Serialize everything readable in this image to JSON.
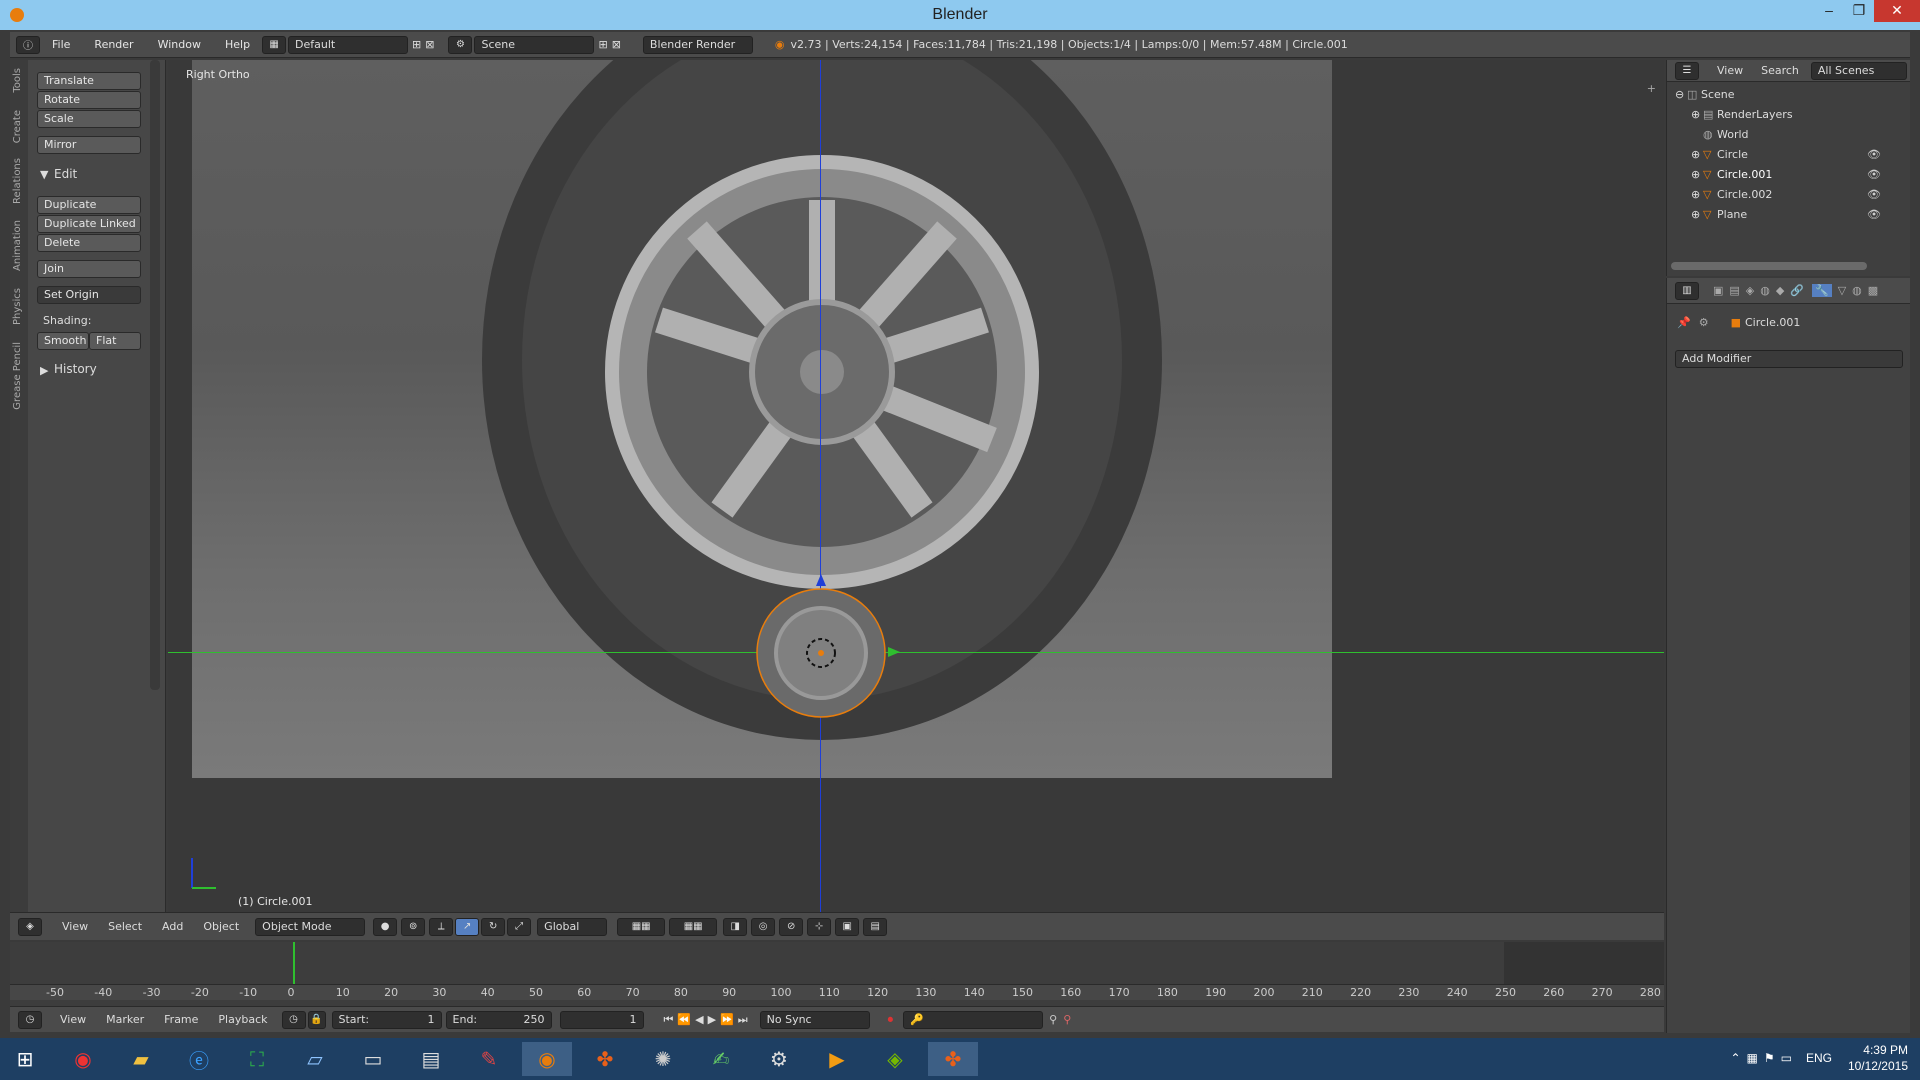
{
  "window": {
    "title": "Blender",
    "minimize": "–",
    "maximize": "❐",
    "close": "✕"
  },
  "infobar": {
    "menus": [
      "File",
      "Render",
      "Window",
      "Help"
    ],
    "screen_layout": "Default",
    "scene": "Scene",
    "render_engine": "Blender Render",
    "stats": "v2.73 | Verts:24,154 | Faces:11,784 | Tris:21,198 | Objects:1/4 | Lamps:0/0 | Mem:57.48M | Circle.001"
  },
  "toolshelf": {
    "tabs": [
      "Tools",
      "Create",
      "Relations",
      "Animation",
      "Physics",
      "Grease Pencil"
    ],
    "transform_buttons": [
      "Translate",
      "Rotate",
      "Scale"
    ],
    "mirror": "Mirror",
    "edit_header": "Edit",
    "edit_buttons": [
      "Duplicate",
      "Duplicate Linked",
      "Delete"
    ],
    "join": "Join",
    "set_origin": "Set Origin",
    "shading_label": "Shading:",
    "smooth": "Smooth",
    "flat": "Flat",
    "history": "History"
  },
  "viewport": {
    "view_name": "Right Ortho",
    "object_label": "(1) Circle.001"
  },
  "viewport_header": {
    "menus": [
      "View",
      "Select",
      "Add",
      "Object"
    ],
    "mode": "Object Mode",
    "orientation": "Global"
  },
  "outliner": {
    "header": {
      "view": "View",
      "search": "Search",
      "scenes": "All Scenes"
    },
    "items": [
      {
        "label": "Scene",
        "icon": "scene-icon"
      },
      {
        "label": "RenderLayers",
        "icon": "renderlayers-icon"
      },
      {
        "label": "World",
        "icon": "world-icon"
      },
      {
        "label": "Circle",
        "icon": "mesh-icon"
      },
      {
        "label": "Circle.001",
        "icon": "mesh-icon"
      },
      {
        "label": "Circle.002",
        "icon": "mesh-icon"
      },
      {
        "label": "Plane",
        "icon": "mesh-icon"
      }
    ]
  },
  "properties": {
    "object_name": "Circle.001",
    "add_modifier": "Add Modifier"
  },
  "timeline": {
    "ticks": [
      "-50",
      "-40",
      "-30",
      "-20",
      "-10",
      "0",
      "10",
      "20",
      "30",
      "40",
      "50",
      "60",
      "70",
      "80",
      "90",
      "100",
      "110",
      "120",
      "130",
      "140",
      "150",
      "160",
      "170",
      "180",
      "190",
      "200",
      "210",
      "220",
      "230",
      "240",
      "250",
      "260",
      "270",
      "280"
    ],
    "menus": [
      "View",
      "Marker",
      "Frame",
      "Playback"
    ],
    "start_label": "Start:",
    "start_value": "1",
    "end_label": "End:",
    "end_value": "250",
    "current_frame": "1",
    "sync": "No Sync"
  },
  "taskbar": {
    "lang": "ENG",
    "time": "4:39 PM",
    "date": "10/12/2015"
  },
  "colors": {
    "accent": "#e87d0d",
    "selected": "#5680c2",
    "x_axis": "#2fbf2f",
    "z_axis": "#1f3fd8"
  }
}
